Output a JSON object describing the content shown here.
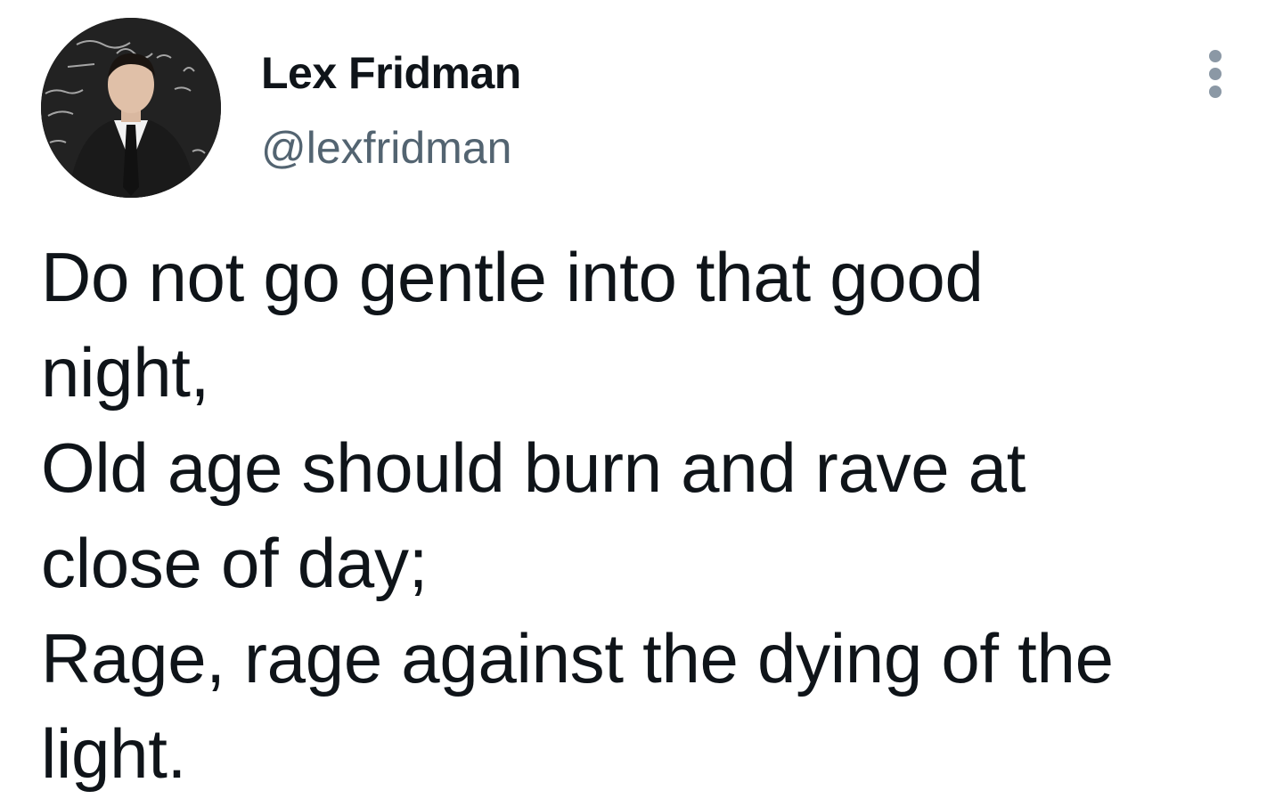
{
  "author": {
    "display_name": "Lex Fridman",
    "handle": "@lexfridman",
    "avatar_icon": "profile-photo"
  },
  "menu": {
    "icon": "more-horizontal-icon"
  },
  "tweet": {
    "lines": [
      "Do not go gentle into that good",
      "night,",
      "Old age should burn and rave at",
      "close of day;",
      "Rage, rage against the dying of the",
      "light."
    ]
  },
  "colors": {
    "text": "#0f1419",
    "secondary": "#536471",
    "menu_dots": "#8b98a5",
    "background": "#ffffff"
  }
}
